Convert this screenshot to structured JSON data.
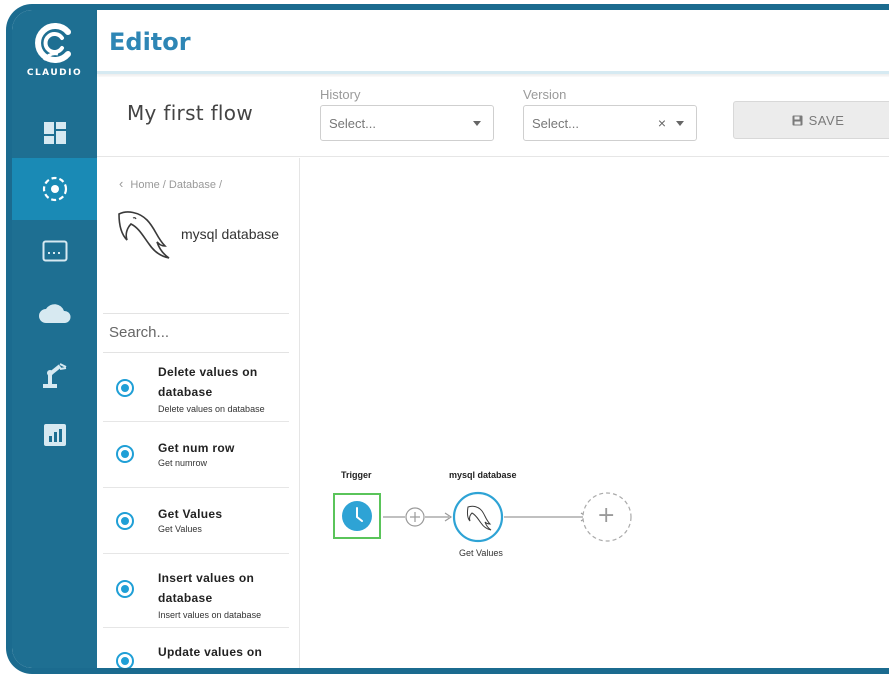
{
  "app": {
    "brand": "CLAUDIO",
    "title": "Editor"
  },
  "nav": {
    "items": [
      {
        "icon": "dashboard-icon"
      },
      {
        "icon": "flow-target-icon",
        "active": true
      },
      {
        "icon": "terminal-icon"
      },
      {
        "icon": "cloud-icon"
      },
      {
        "icon": "robot-arm-icon"
      },
      {
        "icon": "report-chart-icon"
      }
    ]
  },
  "flow": {
    "name": "My first flow",
    "history": {
      "label": "History",
      "placeholder": "Select..."
    },
    "version": {
      "label": "Version",
      "placeholder": "Select...",
      "clear": "×"
    },
    "save_label": "SAVE"
  },
  "panel": {
    "breadcrumb": "Home / Database /",
    "db_name": "mysql database",
    "search_placeholder": "Search...",
    "operations": [
      {
        "title": "Delete values on database",
        "subtitle": "Delete values on database"
      },
      {
        "title": "Get num row",
        "subtitle": "Get numrow"
      },
      {
        "title": "Get Values",
        "subtitle": "Get Values"
      },
      {
        "title": "Insert values on database",
        "subtitle": "Insert values on database"
      },
      {
        "title": "Update values on",
        "subtitle": ""
      }
    ]
  },
  "canvas": {
    "trigger_label": "Trigger",
    "db_node_label": "mysql database",
    "db_node_sub": "Get Values",
    "add_symbol": "+"
  },
  "colors": {
    "rail": "#1e6f92",
    "rail_active": "#1a8ab5",
    "accent": "#2e86b5",
    "radio": "#1f9fd6",
    "trigger_border": "#5ac45a"
  }
}
